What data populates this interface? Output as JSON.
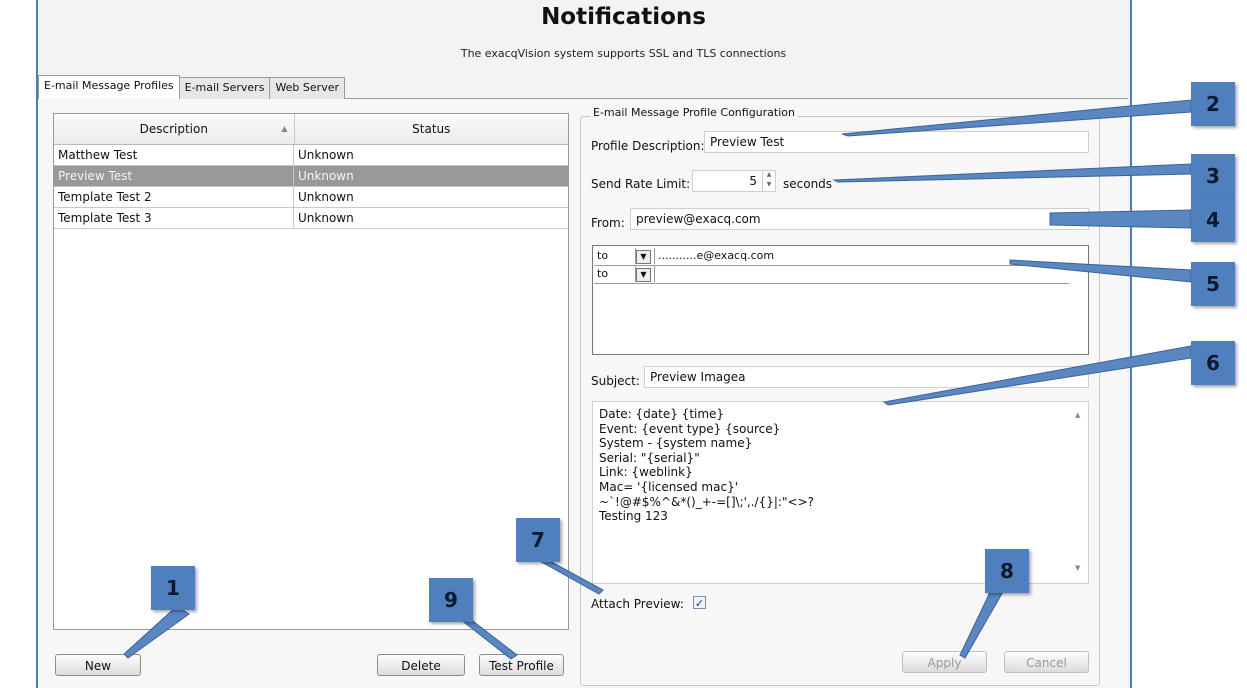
{
  "header": {
    "title": "Notifications",
    "subtitle": "The exacqVision system supports SSL and TLS connections"
  },
  "tabs": [
    {
      "label": "E-mail Message Profiles",
      "active": true
    },
    {
      "label": "E-mail Servers",
      "active": false
    },
    {
      "label": "Web Server",
      "active": false
    }
  ],
  "profiles": {
    "columns": [
      "Description",
      "Status"
    ],
    "rows": [
      {
        "description": "Matthew Test",
        "status": "Unknown",
        "selected": false
      },
      {
        "description": "Preview Test",
        "status": "Unknown",
        "selected": true
      },
      {
        "description": "Template Test 2",
        "status": "Unknown",
        "selected": false
      },
      {
        "description": "Template Test 3",
        "status": "Unknown",
        "selected": false
      }
    ],
    "new_label": "New",
    "delete_label": "Delete",
    "test_label": "Test Profile"
  },
  "config": {
    "legend": "E-mail Message Profile Configuration",
    "profile_desc_label": "Profile Description:",
    "profile_desc_value": "Preview Test",
    "send_rate_label": "Send Rate Limit:",
    "send_rate_value": "5",
    "send_rate_unit": "seconds",
    "from_label": "From:",
    "from_value": "preview@exacq.com",
    "recipients": [
      {
        "type": "to",
        "address": "...........e@exacq.com"
      },
      {
        "type": "to",
        "address": ""
      }
    ],
    "subject_label": "Subject:",
    "subject_value": "Preview Imagea",
    "body_lines": [
      "Date: {date} {time}",
      "Event: {event type} {source}",
      "System - {system name}",
      "Serial: \"{serial}\"",
      "Link: {weblink}",
      "Mac= '{licensed mac}'",
      "~`!@#$%^&*()_+-=[]\\;',./{}|:\"<>?",
      "Testing 123"
    ],
    "attach_label": "Attach Preview:",
    "attach_checked": true,
    "apply_label": "Apply",
    "cancel_label": "Cancel"
  },
  "callouts": [
    "1",
    "2",
    "3",
    "4",
    "5",
    "6",
    "7",
    "8",
    "9"
  ],
  "colors": {
    "callout": "#4f7fbd",
    "selected_row": "#999999",
    "window_border": "#4a7fb5"
  }
}
